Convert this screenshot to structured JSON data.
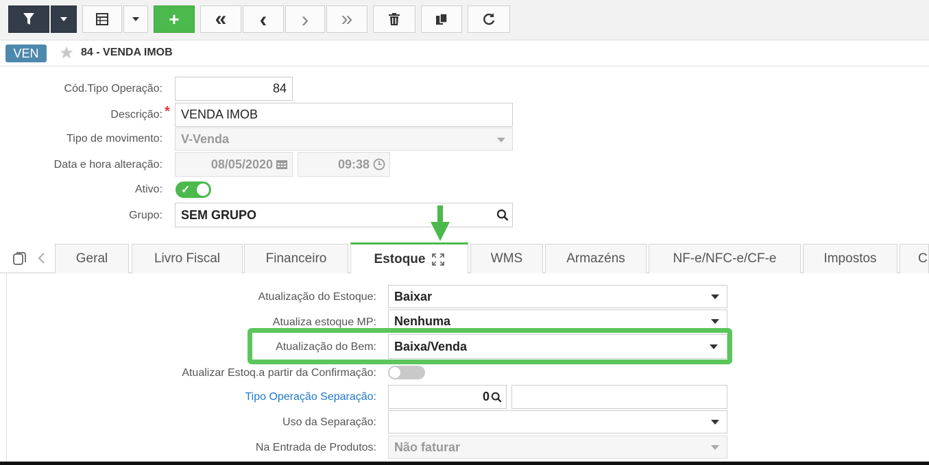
{
  "toolbar": {
    "buttons": [
      {
        "name": "filter",
        "icon": "filter-icon"
      },
      {
        "name": "filter-dropdown",
        "icon": "caret-down-icon"
      },
      {
        "name": "grid-view",
        "icon": "grid-icon"
      },
      {
        "name": "view-dropdown",
        "icon": "caret-down-icon"
      },
      {
        "name": "add",
        "label": "+"
      },
      {
        "name": "first",
        "label": "«"
      },
      {
        "name": "previous",
        "label": "‹"
      },
      {
        "name": "next",
        "label": "›"
      },
      {
        "name": "last",
        "label": "»"
      },
      {
        "name": "delete",
        "icon": "trash-icon"
      },
      {
        "name": "copy",
        "icon": "copy-icon"
      },
      {
        "name": "refresh",
        "icon": "refresh-icon"
      }
    ]
  },
  "header": {
    "badge": "VEN",
    "title": "84 - VENDA IMOB"
  },
  "form": {
    "cod_label": "Cód.Tipo Operação:",
    "cod_value": "84",
    "desc_label": "Descrição:",
    "desc_required": "*",
    "desc_value": "VENDA IMOB",
    "tipo_label": "Tipo de movimento:",
    "tipo_value": "V-Venda",
    "data_label": "Data e hora alteração:",
    "data_value": "08/05/2020",
    "hora_value": "09:38",
    "ativo_label": "Ativo:",
    "grupo_label": "Grupo:",
    "grupo_value": "SEM GRUPO"
  },
  "tabs": [
    "Geral",
    "Livro Fiscal",
    "Financeiro",
    "Estoque",
    "WMS",
    "Armazéns",
    "NF-e/NFC-e/CF-e",
    "Impostos",
    "C"
  ],
  "active_tab": "Estoque",
  "estoque": {
    "atualizacao_estoque_label": "Atualização do Estoque:",
    "atualizacao_estoque_value": "Baixar",
    "atualiza_mp_label": "Atualiza estoque MP:",
    "atualiza_mp_value": "Nenhuma",
    "atualizacao_bem_label": "Atualização do Bem:",
    "atualizacao_bem_value": "Baixa/Venda",
    "confirmacao_label": "Atualizar Estoq.a partir da Confirmação:",
    "tipo_sep_label": "Tipo Operação Separação:",
    "tipo_sep_value": "0",
    "uso_sep_label": "Uso da Separação:",
    "uso_sep_value": "",
    "entrada_label": "Na Entrada de Produtos:",
    "entrada_value": "Não faturar"
  },
  "colors": {
    "accent_green": "#4cb94c",
    "badge_blue": "#4d88ad",
    "toolbar_dark": "#333c48",
    "link_blue": "#1e78c8",
    "required_red": "#e53935"
  }
}
